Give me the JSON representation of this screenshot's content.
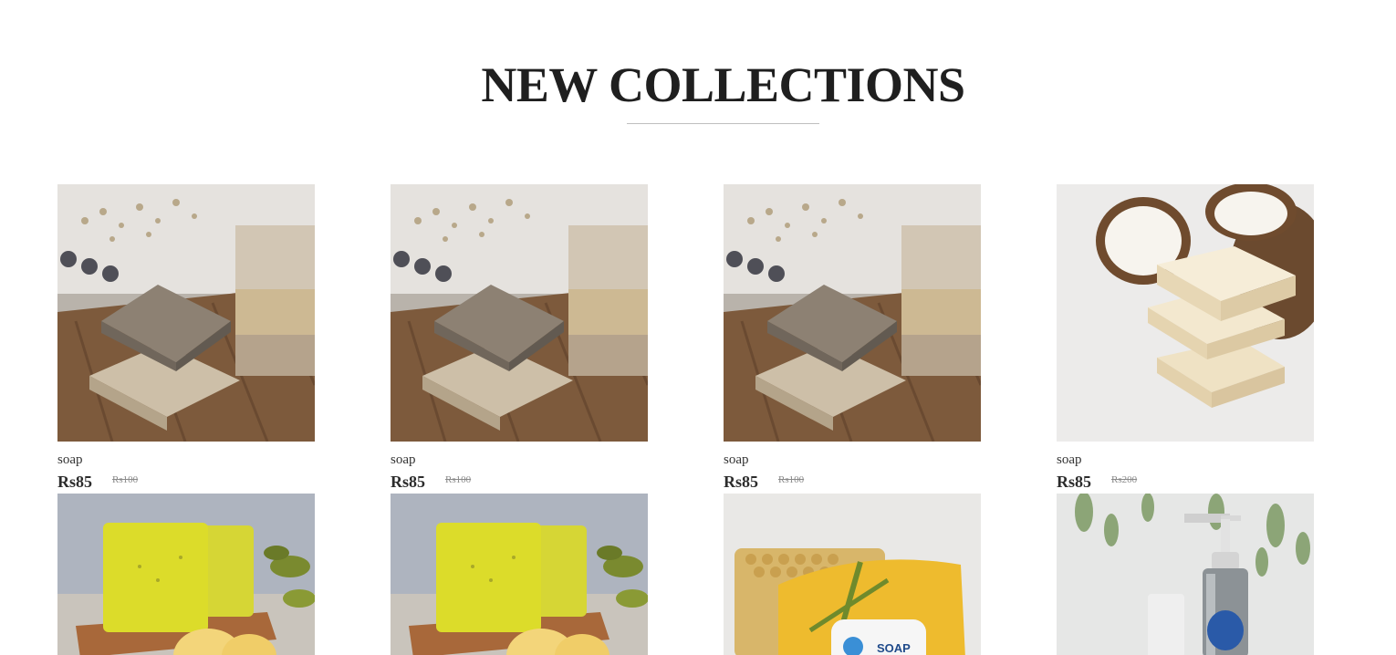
{
  "section": {
    "title": "NEW COLLECTIONS"
  },
  "products": [
    {
      "name": "soap",
      "price": "Rs85",
      "old_price": "Rs100",
      "image": "herbal-soap-bars-on-wood"
    },
    {
      "name": "soap",
      "price": "Rs85",
      "old_price": "Rs100",
      "image": "herbal-soap-bars-on-wood"
    },
    {
      "name": "soap",
      "price": "Rs85",
      "old_price": "Rs100",
      "image": "herbal-soap-bars-on-wood"
    },
    {
      "name": "soap",
      "price": "Rs85",
      "old_price": "Rs200",
      "image": "coconut-soap-bars"
    },
    {
      "image": "lemon-glycerin-soap"
    },
    {
      "image": "lemon-glycerin-soap"
    },
    {
      "image": "honeycomb-organic-soap",
      "label": "SOAP"
    },
    {
      "image": "hand-wash-bottle"
    }
  ],
  "colors": {
    "text": "#2c2c2c",
    "muted": "#8a8a8a",
    "underline": "#bfbfbf"
  }
}
